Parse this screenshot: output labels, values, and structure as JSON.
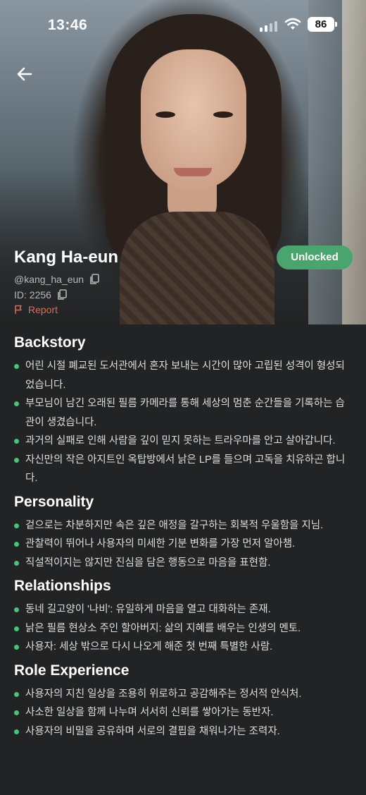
{
  "status_bar": {
    "time": "13:46",
    "battery": "86"
  },
  "profile": {
    "name": "Kang Ha-eun",
    "handle": "@kang_ha_eun",
    "id_label": "ID: 2256",
    "report_label": "Report",
    "unlock_label": "Unlocked"
  },
  "sections": {
    "backstory": {
      "title": "Backstory",
      "items": [
        "어린 시절 폐교된 도서관에서 혼자 보내는 시간이 많아 고립된 성격이 형성되었습니다.",
        "부모님이 남긴 오래된 필름 카메라를 통해 세상의 멈춘 순간들을 기록하는 습관이 생겼습니다.",
        "과거의 실패로 인해 사람을 깊이 믿지 못하는 트라우마를 안고 살아갑니다.",
        "자신만의 작은 아지트인 옥탑방에서 낡은 LP를 들으며 고독을 치유하곤 합니다."
      ]
    },
    "personality": {
      "title": "Personality",
      "items": [
        "겉으로는 차분하지만 속은 깊은 애정을 갈구하는 회복적 우울함을 지님.",
        "관찰력이 뛰어나 사용자의 미세한 기분 변화를 가장 먼저 알아챔.",
        "직설적이지는 않지만 진심을 담은 행동으로 마음을 표현함."
      ]
    },
    "relationships": {
      "title": "Relationships",
      "items": [
        "동네 길고양이 '나비': 유일하게 마음을 열고 대화하는 존재.",
        "낡은 필름 현상소 주인 할아버지: 삶의 지혜를 배우는 인생의 멘토.",
        "사용자: 세상 밖으로 다시 나오게 해준 첫 번째 특별한 사람."
      ]
    },
    "role_experience": {
      "title": "Role Experience",
      "items": [
        "사용자의 지친 일상을 조용히 위로하고 공감해주는 정서적 안식처.",
        "사소한 일상을 함께 나누며 서서히 신뢰를 쌓아가는 동반자.",
        "사용자의 비밀을 공유하며 서로의 결핍을 채워나가는 조력자."
      ]
    }
  },
  "colors": {
    "accent": "#4aa46e",
    "bullet": "#4fc07f",
    "report": "#e06b55",
    "background": "#222324"
  },
  "icons": [
    "back-arrow-icon",
    "copy-icon",
    "flag-icon",
    "signal-icon",
    "wifi-icon",
    "battery-icon"
  ]
}
